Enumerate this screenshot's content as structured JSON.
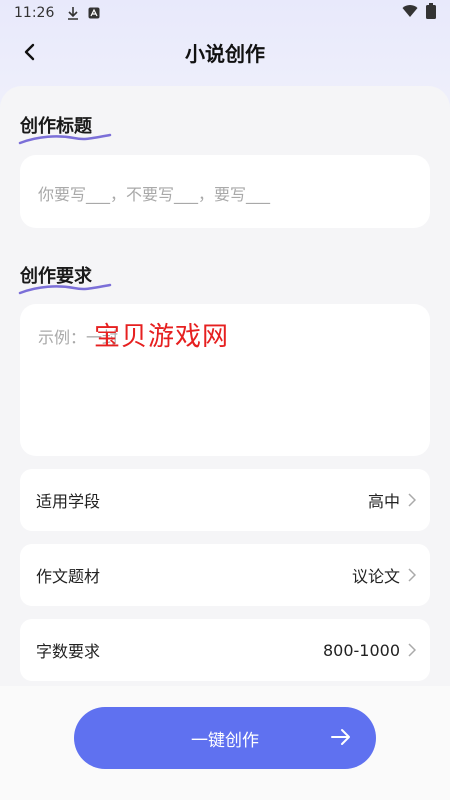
{
  "status_bar": {
    "time": "11:26",
    "icons": [
      "download-icon",
      "a-icon",
      "wifi-icon",
      "battery-icon"
    ]
  },
  "app_bar": {
    "title": "小说创作",
    "back_icon": "back-arrow-icon"
  },
  "sections": {
    "theme_title": "创作标题",
    "theme_placeholder": "你要写___，不要写___，要写___",
    "requirement_title": "创作要求",
    "requirement_placeholder": "示例：一封",
    "watermark": "宝贝游戏网"
  },
  "options": [
    {
      "label": "适用学段",
      "value": "高中"
    },
    {
      "label": "作文题材",
      "value": "议论文"
    },
    {
      "label": "字数要求",
      "value": "800-1000"
    }
  ],
  "cta": {
    "label": "一键创作",
    "icon": "arrow-right-icon"
  },
  "colors": {
    "accent": "#5f71f0",
    "underline": "#7b6fd8",
    "watermark": "#e62020"
  }
}
